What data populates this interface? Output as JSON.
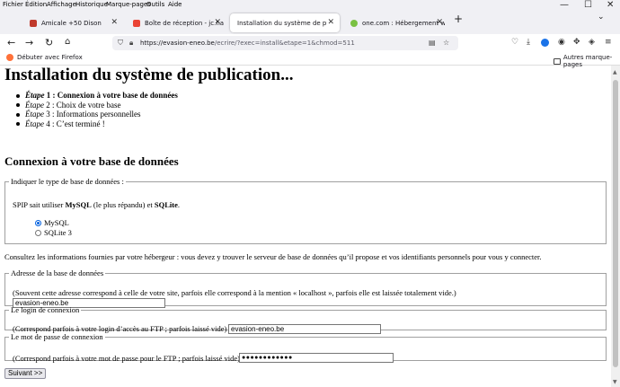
{
  "menu": [
    "Fichier",
    "Édition",
    "Affichage",
    "Historique",
    "Marque-pages",
    "Outils",
    "Aide"
  ],
  "tabs": [
    {
      "title": "Amicale +50 Dison",
      "color": "#c0392b",
      "active": false
    },
    {
      "title": "Boîte de réception - jc.hamers@",
      "color": "#ea4335",
      "active": false
    },
    {
      "title": "Installation du système de publication",
      "color": "#ffffff",
      "active": true
    },
    {
      "title": "one.com : Hébergement web, do",
      "color": "#7ac143",
      "active": false
    }
  ],
  "address": {
    "host": "https://evasion-eneo.be",
    "path": "/ecrire/?exec=install&etape=1&chmod=511"
  },
  "bookmarks": {
    "firefox": "Débuter avec Firefox",
    "other": "Autres marque-pages"
  },
  "page": {
    "title": "Installation du système de publication...",
    "steps": [
      {
        "label": "Étape",
        "num": " 1 : ",
        "text": "Connexion à votre base de données",
        "current": true
      },
      {
        "label": "Étape",
        "num": " 2 : ",
        "text": "Choix de votre base",
        "current": false
      },
      {
        "label": "Étape",
        "num": " 3 : ",
        "text": "Informations personnelles",
        "current": false
      },
      {
        "label": "Étape",
        "num": " 4 : ",
        "text": "C’est terminé !",
        "current": false
      }
    ],
    "section_title": "Connexion à votre base de données",
    "dbtype": {
      "legend": "Indiquer le type de base de données :",
      "text_pre": "SPIP sait utiliser ",
      "mysql": "MySQL",
      "text_mid": " (le plus répandu) et ",
      "sqlite": "SQLite",
      "text_end": ".",
      "options": [
        {
          "label": "MySQL",
          "selected": true
        },
        {
          "label": "SQLite 3",
          "selected": false
        }
      ]
    },
    "intro": "Consultez les informations fournies par votre hébergeur : vous devez y trouver le serveur de base de données qu’il propose et vos identifiants personnels pour vous y connecter.",
    "server": {
      "legend": "Adresse de la base de données",
      "help": "(Souvent cette adresse correspond à celle de votre site, parfois elle correspond à la mention « localhost », parfois elle est laissée totalement vide.)",
      "value": "evasion-eneo.be"
    },
    "login": {
      "legend": "Le login de connexion",
      "help": "(Correspond parfois à votre login d’accès au FTP ; parfois laissé vide)",
      "value": "evasion-eneo.be"
    },
    "password": {
      "legend": "Le mot de passe de connexion",
      "help": "(Correspond parfois à votre mot de passe pour le FTP ; parfois laissé vide)",
      "value": "●●●●●●●●●●●●"
    },
    "submit": "Suivant >>"
  }
}
